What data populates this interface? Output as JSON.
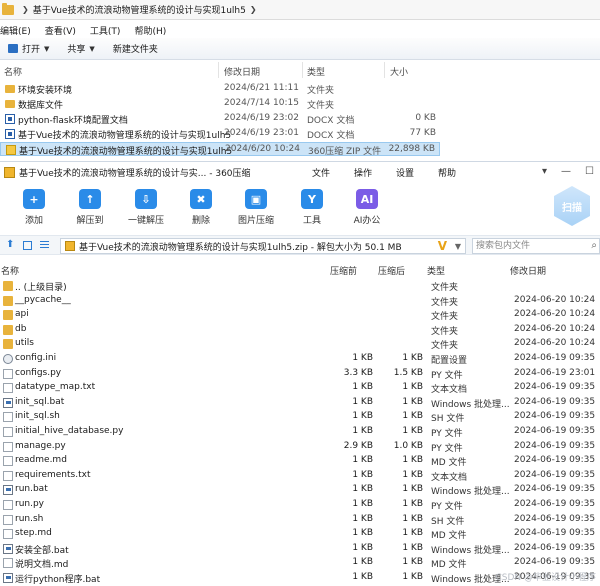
{
  "explorer": {
    "breadcrumb": "基于Vue技术的流浪动物管理系统的设计与实现1ulh5",
    "menu": [
      "编辑(E)",
      "查看(V)",
      "工具(T)",
      "帮助(H)"
    ],
    "toolbar": {
      "open_label": "打开",
      "share_label": "共享",
      "new_folder_label": "新建文件夹"
    },
    "columns": {
      "name": "名称",
      "date": "修改日期",
      "type": "类型",
      "size": "大小"
    },
    "rows": [
      {
        "name": "环境安装环境",
        "date": "2024/6/21 11:11",
        "type": "文件夹",
        "size": "",
        "icon": "folder-icon"
      },
      {
        "name": "数据库文件",
        "date": "2024/7/14 10:15",
        "type": "文件夹",
        "size": "",
        "icon": "folder-icon"
      },
      {
        "name": "python-flask环境配置文档",
        "date": "2024/6/19 23:02",
        "type": "DOCX 文档",
        "size": "0 KB",
        "icon": "docx-icon"
      },
      {
        "name": "基于Vue技术的流浪动物管理系统的设计与实现1ulh5",
        "date": "2024/6/19 23:01",
        "type": "DOCX 文档",
        "size": "77 KB",
        "icon": "docx-icon"
      },
      {
        "name": "基于Vue技术的流浪动物管理系统的设计与实现1ulh5",
        "date": "2024/6/20 10:24",
        "type": "360压缩 ZIP 文件",
        "size": "22,898 KB",
        "icon": "zip-icon",
        "selected": true
      }
    ]
  },
  "zip": {
    "title": "基于Vue技术的流浪动物管理系统的设计与实... - 360压缩",
    "menu": [
      "文件",
      "操作",
      "设置",
      "帮助"
    ],
    "toolbar": [
      {
        "label": "添加",
        "icon": "add-icon",
        "color": "#2a8be8"
      },
      {
        "label": "解压到",
        "icon": "extract-to-icon",
        "color": "#2a8be8"
      },
      {
        "label": "一键解压",
        "icon": "one-click-extract-icon",
        "color": "#2a8be8"
      },
      {
        "label": "删除",
        "icon": "delete-icon",
        "color": "#2a8be8"
      },
      {
        "label": "图片压缩",
        "icon": "image-compress-icon",
        "color": "#2a8be8"
      },
      {
        "label": "工具",
        "icon": "tools-icon",
        "color": "#2a8be8"
      },
      {
        "label": "AI办公",
        "icon": "ai-office-icon",
        "color": "#2a8be8"
      }
    ],
    "scan_label": "扫描",
    "path": "基于Vue技术的流浪动物管理系统的设计与实现1ulh5.zip - 解包大小为 50.1 MB",
    "search_placeholder": "搜索包内文件",
    "columns": {
      "name": "名称",
      "compressed": "压缩前",
      "original": "压缩后",
      "type": "类型",
      "date": "修改日期"
    },
    "rows": [
      {
        "name": ".. (上级目录)",
        "compressed": "",
        "original": "",
        "type": "文件夹",
        "date": "",
        "icon": "folder-icon"
      },
      {
        "name": "__pycache__",
        "compressed": "",
        "original": "",
        "type": "文件夹",
        "date": "2024-06-20 10:24",
        "icon": "folder-icon"
      },
      {
        "name": "api",
        "compressed": "",
        "original": "",
        "type": "文件夹",
        "date": "2024-06-20 10:24",
        "icon": "folder-icon"
      },
      {
        "name": "db",
        "compressed": "",
        "original": "",
        "type": "文件夹",
        "date": "2024-06-20 10:24",
        "icon": "folder-icon"
      },
      {
        "name": "utils",
        "compressed": "",
        "original": "",
        "type": "文件夹",
        "date": "2024-06-20 10:24",
        "icon": "folder-icon"
      },
      {
        "name": "config.ini",
        "compressed": "1 KB",
        "original": "1 KB",
        "type": "配置设置",
        "date": "2024-06-19 09:35",
        "icon": "settings-file-icon"
      },
      {
        "name": "configs.py",
        "compressed": "3.3 KB",
        "original": "1.5 KB",
        "type": "PY 文件",
        "date": "2024-06-19 23:01",
        "icon": "file-icon"
      },
      {
        "name": "datatype_map.txt",
        "compressed": "1 KB",
        "original": "1 KB",
        "type": "文本文档",
        "date": "2024-06-19 09:35",
        "icon": "file-icon"
      },
      {
        "name": "init_sql.bat",
        "compressed": "1 KB",
        "original": "1 KB",
        "type": "Windows 批处理...",
        "date": "2024-06-19 09:35",
        "icon": "batch-file-icon"
      },
      {
        "name": "init_sql.sh",
        "compressed": "1 KB",
        "original": "1 KB",
        "type": "SH 文件",
        "date": "2024-06-19 09:35",
        "icon": "file-icon"
      },
      {
        "name": "initial_hive_database.py",
        "compressed": "1 KB",
        "original": "1 KB",
        "type": "PY 文件",
        "date": "2024-06-19 09:35",
        "icon": "file-icon"
      },
      {
        "name": "manage.py",
        "compressed": "2.9 KB",
        "original": "1.0 KB",
        "type": "PY 文件",
        "date": "2024-06-19 09:35",
        "icon": "file-icon"
      },
      {
        "name": "readme.md",
        "compressed": "1 KB",
        "original": "1 KB",
        "type": "MD 文件",
        "date": "2024-06-19 09:35",
        "icon": "file-icon"
      },
      {
        "name": "requirements.txt",
        "compressed": "1 KB",
        "original": "1 KB",
        "type": "文本文档",
        "date": "2024-06-19 09:35",
        "icon": "file-icon"
      },
      {
        "name": "run.bat",
        "compressed": "1 KB",
        "original": "1 KB",
        "type": "Windows 批处理...",
        "date": "2024-06-19 09:35",
        "icon": "batch-file-icon"
      },
      {
        "name": "run.py",
        "compressed": "1 KB",
        "original": "1 KB",
        "type": "PY 文件",
        "date": "2024-06-19 09:35",
        "icon": "file-icon"
      },
      {
        "name": "run.sh",
        "compressed": "1 KB",
        "original": "1 KB",
        "type": "SH 文件",
        "date": "2024-06-19 09:35",
        "icon": "file-icon"
      },
      {
        "name": "step.md",
        "compressed": "1 KB",
        "original": "1 KB",
        "type": "MD 文件",
        "date": "2024-06-19 09:35",
        "icon": "file-icon"
      },
      {
        "name": "安装全部.bat",
        "compressed": "1 KB",
        "original": "1 KB",
        "type": "Windows 批处理...",
        "date": "2024-06-19 09:35",
        "icon": "batch-file-icon"
      },
      {
        "name": "说明文档.md",
        "compressed": "1 KB",
        "original": "1 KB",
        "type": "MD 文件",
        "date": "2024-06-19 09:35",
        "icon": "file-icon"
      },
      {
        "name": "运行python程序.bat",
        "compressed": "1 KB",
        "original": "1 KB",
        "type": "Windows 批处理...",
        "date": "2024-06-19 09:35",
        "icon": "batch-file-icon"
      }
    ]
  },
  "watermark": "CSDN @毕业设计小程序"
}
